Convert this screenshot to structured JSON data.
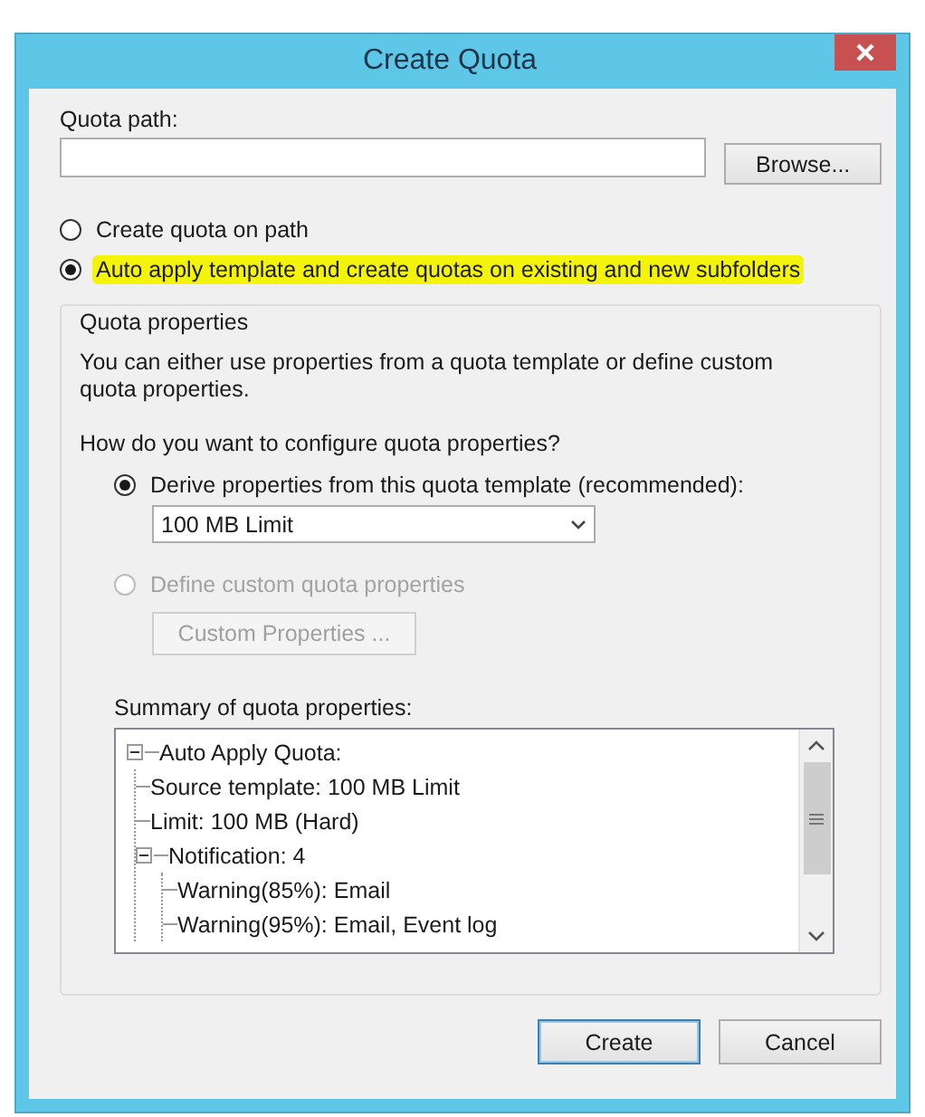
{
  "window": {
    "title": "Create Quota"
  },
  "quota_path": {
    "label": "Quota path:",
    "browse_button": "Browse..."
  },
  "mode_options": [
    {
      "label": "Create quota on path",
      "selected": false,
      "highlighted": false
    },
    {
      "label": "Auto apply template and create quotas on existing and new subfolders",
      "selected": true,
      "highlighted": true
    }
  ],
  "quota_properties": {
    "title": "Quota properties",
    "description": "You can either use properties from a quota template or define custom quota properties.",
    "question": "How do you want to configure quota properties?",
    "options": [
      {
        "label": "Derive properties from this quota template (recommended):",
        "selected": true,
        "disabled": false
      },
      {
        "label": "Define custom quota properties",
        "selected": false,
        "disabled": true
      }
    ],
    "template_dropdown": {
      "value": "100 MB Limit"
    },
    "custom_button": {
      "label": "Custom Properties ...",
      "disabled": true
    },
    "summary_label": "Summary of quota properties:",
    "summary_tree": [
      {
        "label": "Auto Apply Quota:",
        "expanded": true,
        "children": [
          {
            "label": "Source template: 100 MB Limit"
          },
          {
            "label": "Limit: 100 MB (Hard)"
          },
          {
            "label": "Notification: 4",
            "expanded": true,
            "children": [
              {
                "label": "Warning(85%): Email"
              },
              {
                "label": "Warning(95%): Email, Event log"
              }
            ]
          }
        ]
      }
    ]
  },
  "buttons": [
    {
      "label": "Create",
      "default": true
    },
    {
      "label": "Cancel",
      "default": false
    }
  ]
}
